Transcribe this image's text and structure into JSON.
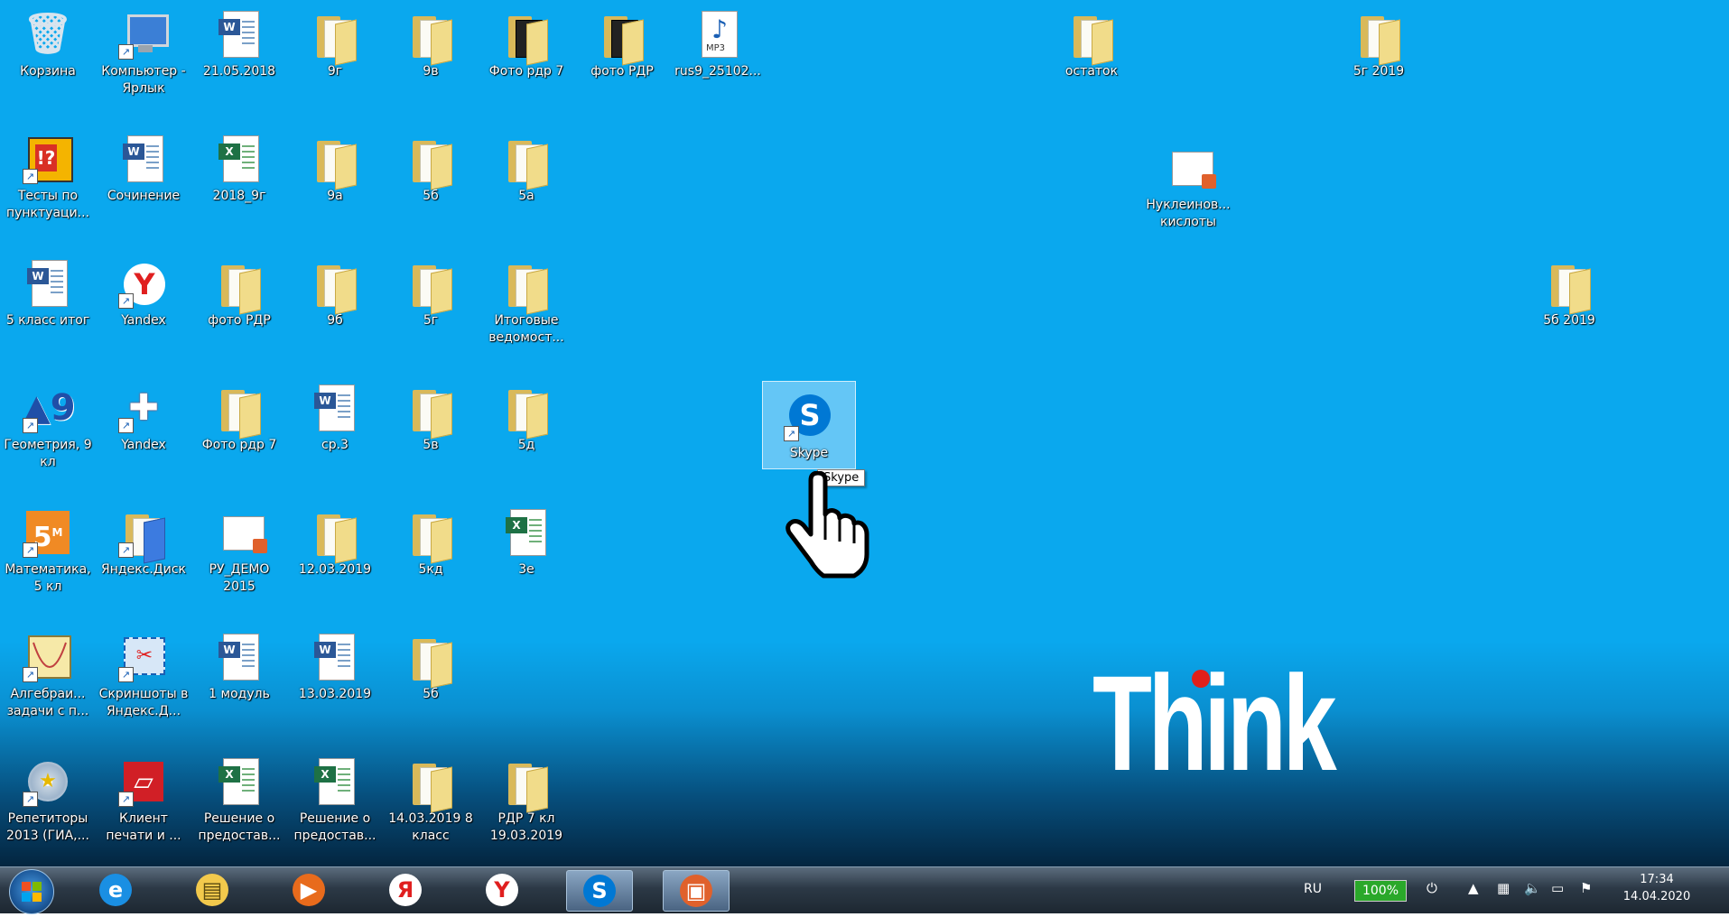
{
  "desktop": {
    "icons": [
      {
        "label": "Корзина",
        "type": "recycle"
      },
      {
        "label": "Компьютер - Ярлык",
        "type": "computer"
      },
      {
        "label": "21.05.2018",
        "type": "word"
      },
      {
        "label": "9г",
        "type": "folder"
      },
      {
        "label": "9в",
        "type": "folder"
      },
      {
        "label": "Фото рдр 7",
        "type": "folder-dark"
      },
      {
        "label": "фото РДР",
        "type": "folder-dark"
      },
      {
        "label": "rus9_25102...",
        "type": "mp3"
      },
      {
        "label": "остаток",
        "type": "folder"
      },
      {
        "label": "5г 2019",
        "type": "folder"
      },
      {
        "label": "Тесты по пунктуаци...",
        "type": "quiz"
      },
      {
        "label": "Сочинениe",
        "type": "word"
      },
      {
        "label": "2018_9г",
        "type": "excel"
      },
      {
        "label": "9а",
        "type": "folder"
      },
      {
        "label": "5б",
        "type": "folder-zip"
      },
      {
        "label": "5а",
        "type": "folder"
      },
      {
        "label": "Нуклеинов... кислоты",
        "type": "presentation"
      },
      {
        "label": "5 класс итог",
        "type": "word"
      },
      {
        "label": "Yandex",
        "type": "yandex"
      },
      {
        "label": "фото РДР",
        "type": "folder-zip"
      },
      {
        "label": "9б",
        "type": "folder"
      },
      {
        "label": "5г",
        "type": "folder"
      },
      {
        "label": "Итоговые ведомост...",
        "type": "folder"
      },
      {
        "label": "5б 2019",
        "type": "folder"
      },
      {
        "label": "Геометрия, 9 кл",
        "type": "geometry"
      },
      {
        "label": "Yandex",
        "type": "yandex-box"
      },
      {
        "label": "Фото рдр 7",
        "type": "folder-zip"
      },
      {
        "label": "ср.3",
        "type": "word"
      },
      {
        "label": "5в",
        "type": "folder"
      },
      {
        "label": "5д",
        "type": "folder"
      },
      {
        "label": "Skype",
        "type": "skype"
      },
      {
        "label": "Математика, 5 кл",
        "type": "math5"
      },
      {
        "label": "Яндекс.Диск",
        "type": "yadisk"
      },
      {
        "label": "РУ_ДЕМО 2015",
        "type": "presentation"
      },
      {
        "label": "12.03.2019",
        "type": "folder"
      },
      {
        "label": "5кд",
        "type": "folder"
      },
      {
        "label": "3е",
        "type": "excel"
      },
      {
        "label": "Алгебраи... задачи с п...",
        "type": "algebra"
      },
      {
        "label": "Скриншоты в Яндекс.Д...",
        "type": "screenshot"
      },
      {
        "label": "1 модуль",
        "type": "word"
      },
      {
        "label": "13.03.2019",
        "type": "word"
      },
      {
        "label": "5б",
        "type": "folder"
      },
      {
        "label": "Репетиторы 2013 (ГИА,...",
        "type": "cd"
      },
      {
        "label": "Клиент печати и ...",
        "type": "printclient"
      },
      {
        "label": "Решение о предостав...",
        "type": "excel"
      },
      {
        "label": "Решение о предостав...",
        "type": "excel"
      },
      {
        "label": "14.03.2019 8 класс",
        "type": "folder-zip"
      },
      {
        "label": "РДР 7 кл 19.03.2019",
        "type": "folder"
      }
    ],
    "tooltip": "Skype",
    "brand_logo": "Think",
    "colors": {
      "background": "#0aa8ee",
      "brand_dot": "#e0201a"
    }
  },
  "taskbar": {
    "start_icon": "windows-orb-icon",
    "pinned": [
      {
        "name": "internet-explorer-icon",
        "glyph": "e"
      },
      {
        "name": "file-explorer-icon",
        "glyph": "▤"
      },
      {
        "name": "media-player-icon",
        "glyph": "▶"
      },
      {
        "name": "yandex-browser-icon",
        "glyph": "Я"
      },
      {
        "name": "yandex-icon",
        "glyph": "Y"
      },
      {
        "name": "skype-icon",
        "glyph": "S"
      },
      {
        "name": "presentation-app-icon",
        "glyph": "▣"
      }
    ],
    "language": "RU",
    "battery": "100%",
    "time": "17:34",
    "date": "14.04.2020"
  }
}
